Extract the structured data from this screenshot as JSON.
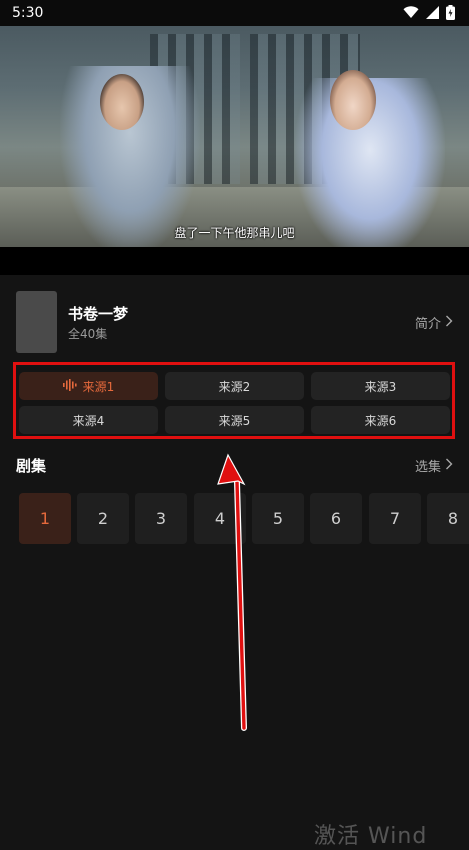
{
  "status_bar": {
    "time": "5:30",
    "icons": [
      "wifi-icon",
      "cellular-signal-icon",
      "battery-icon"
    ]
  },
  "video": {
    "subtitle": "盘了一下午他那串儿吧"
  },
  "drama": {
    "title": "书卷一梦",
    "episodes_count": "全40集",
    "intro_label": "简介"
  },
  "sources": {
    "items": [
      {
        "label": "来源1",
        "active": true
      },
      {
        "label": "来源2",
        "active": false
      },
      {
        "label": "来源3",
        "active": false
      },
      {
        "label": "来源4",
        "active": false
      },
      {
        "label": "来源5",
        "active": false
      },
      {
        "label": "来源6",
        "active": false
      }
    ]
  },
  "episodes": {
    "title": "剧集",
    "select_label": "选集",
    "items": [
      "1",
      "2",
      "3",
      "4",
      "5",
      "6",
      "7",
      "8"
    ]
  },
  "watermark": {
    "text": "激活 Wind"
  },
  "colors": {
    "accent": "#e5693c",
    "highlight_box": "#e01010",
    "annotation_arrow": "#e01010"
  }
}
